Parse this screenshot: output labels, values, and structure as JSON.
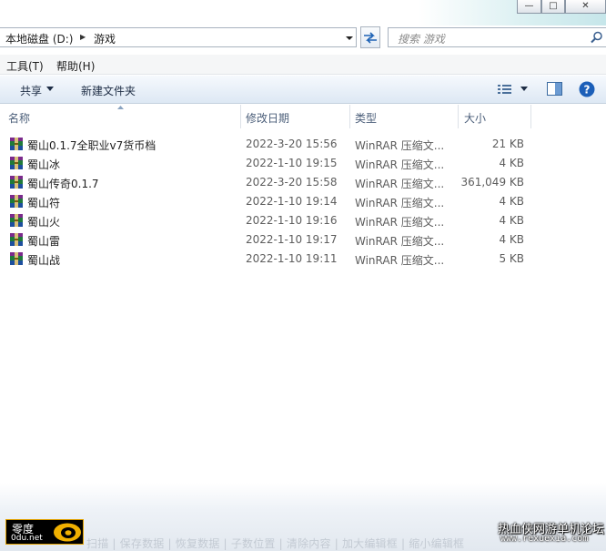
{
  "window": {
    "buttons": {
      "minimize": "—",
      "maximize": "□",
      "close": "✕"
    }
  },
  "address": {
    "segments": [
      "本地磁盘 (D:)",
      "游戏"
    ],
    "separator": "▶"
  },
  "search": {
    "placeholder": "搜索 游戏"
  },
  "menu": {
    "items": [
      "工具(T)",
      "帮助(H)"
    ]
  },
  "commands": {
    "share": "共享",
    "new_folder": "新建文件夹"
  },
  "columns": {
    "name": "名称",
    "modified": "修改日期",
    "type": "类型",
    "size": "大小"
  },
  "files": [
    {
      "name": "蜀山0.1.7全职业v7货币档",
      "modified": "2022-3-20 15:56",
      "type": "WinRAR 压缩文...",
      "size": "21 KB"
    },
    {
      "name": "蜀山冰",
      "modified": "2022-1-10 19:15",
      "type": "WinRAR 压缩文...",
      "size": "4 KB"
    },
    {
      "name": "蜀山传奇0.1.7",
      "modified": "2022-3-20 15:58",
      "type": "WinRAR 压缩文...",
      "size": "361,049 KB"
    },
    {
      "name": "蜀山符",
      "modified": "2022-1-10 19:14",
      "type": "WinRAR 压缩文...",
      "size": "4 KB"
    },
    {
      "name": "蜀山火",
      "modified": "2022-1-10 19:16",
      "type": "WinRAR 压缩文...",
      "size": "4 KB"
    },
    {
      "name": "蜀山雷",
      "modified": "2022-1-10 19:17",
      "type": "WinRAR 压缩文...",
      "size": "4 KB"
    },
    {
      "name": "蜀山战",
      "modified": "2022-1-10 19:11",
      "type": "WinRAR 压缩文...",
      "size": "5 KB"
    }
  ],
  "overlay": {
    "text": "扫描 | 保存数据 | 恢复数据 | 子数位置 | 清除内容 | 加大编辑框 | 缩小编辑框"
  },
  "watermark": {
    "logo_line1": "零度",
    "logo_line2": "0du.net",
    "brand_line1": "热血侠网游单机论坛",
    "brand_line2": "www.rexuexia.com"
  },
  "colors": {
    "accent": "#1e4a8c",
    "help": "#1c5fb8"
  }
}
